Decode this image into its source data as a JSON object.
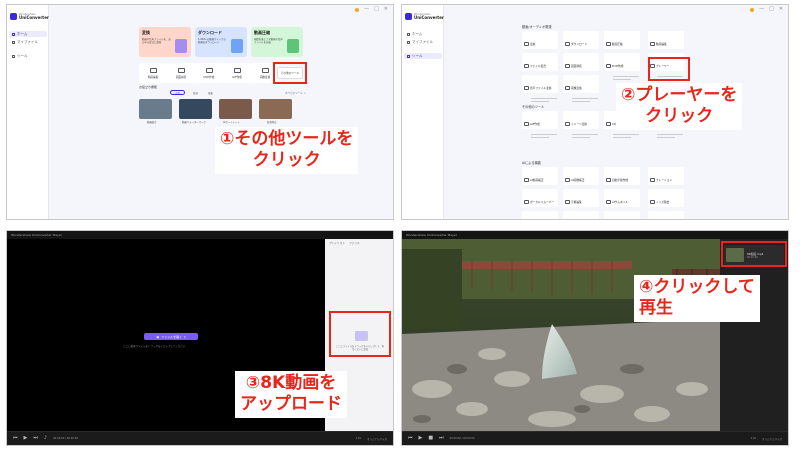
{
  "app": {
    "name": "UniConverter",
    "brand_small": "Wondershare",
    "player_title": "Wondershare UniConverter Player",
    "accent": "#3b2bd6",
    "callout_color": "#e8261b"
  },
  "sidebar": {
    "items": [
      {
        "label": "ホーム",
        "icon": "home-icon"
      },
      {
        "label": "マイファイル",
        "icon": "folder-icon"
      },
      {
        "label": "ツール",
        "icon": "tools-icon"
      }
    ]
  },
  "panel1": {
    "banners": [
      {
        "title": "変換",
        "desc": "動画や音声ファイルを、あらゆる形式に変換",
        "color": "#ffd6c9"
      },
      {
        "title": "ダウンロード",
        "desc": "1,000+の動画サイトから動画をダウンロード",
        "color": "#d6e4ff"
      },
      {
        "title": "動画圧縮",
        "desc": "画質を落とさず動画や音声ファイルを圧縮",
        "color": "#d3f5d8"
      }
    ],
    "tools": [
      "動画編集",
      "画面録画",
      "DVD作成",
      "GIF作成",
      "画像変換"
    ],
    "more_tools": "その他のツール",
    "recent_title": "お役立ち機能",
    "chips": [
      "人気",
      "変換",
      "編集"
    ],
    "all_link": "すべてのツール >",
    "thumbs": [
      {
        "caption": "動画結合",
        "color": "#6a7b8c"
      },
      {
        "caption": "動画ウォーターマーク",
        "color": "#34495e"
      },
      {
        "caption": "AIポートレート",
        "color": "#7a5a4a"
      },
      {
        "caption": "背景除去",
        "color": "#8b6a55"
      }
    ],
    "callout": {
      "line1": "①その他ツールを",
      "line2": "クリック"
    }
  },
  "panel2": {
    "groups": [
      {
        "title": "動画/オーディオ関連"
      },
      {
        "title": "その他のツール"
      },
      {
        "title": "AIによる機能"
      }
    ],
    "cards_g1": [
      "変換",
      "ダウンロード",
      "動画圧縮",
      "動画編集",
      "ファイル結合",
      "画面録画",
      "DVD作成",
      "プレーヤー",
      "音声ファイル変換",
      "画像変換"
    ],
    "cards_g2": [
      "GIF作成",
      "イメージ変換",
      "CD作成",
      "修復"
    ],
    "cards_g3": [
      "AI動画補正",
      "AI画像補正",
      "自動字幕作成",
      "ナレーション",
      "ボーカルリムーバー",
      "字幕編集",
      "AIサムネイル",
      "ノイズ除去",
      "音声から",
      "AI要約",
      "テキストから",
      "ウォーターマーク"
    ],
    "player_card_desc": "あらゆる形式の動画を再生",
    "callout": {
      "line1": "②プレーヤーを",
      "line2": "クリック"
    }
  },
  "panel3": {
    "open_button": "ファイルを開く",
    "open_hint": "ここに動画ファイルをドラッグ＆ドロップしてください",
    "side_tabs": [
      "プレイリスト",
      "ファイル"
    ],
    "side_hint": "ここにファイルをドラッグ＆ドロップして、再生リストに追加",
    "callout": {
      "line1": "③8K動画を",
      "line2": "アップロード"
    }
  },
  "panel4": {
    "playlist_item": {
      "name": "8K動画.mp4",
      "duration": "00:01:00"
    },
    "callout": {
      "line1": "④クリックして",
      "line2": "再生"
    }
  },
  "bottombar": {
    "time": "00:00:00 / 00:00:00",
    "speed": "1.0x",
    "mode": "オリジナルサイズ"
  }
}
